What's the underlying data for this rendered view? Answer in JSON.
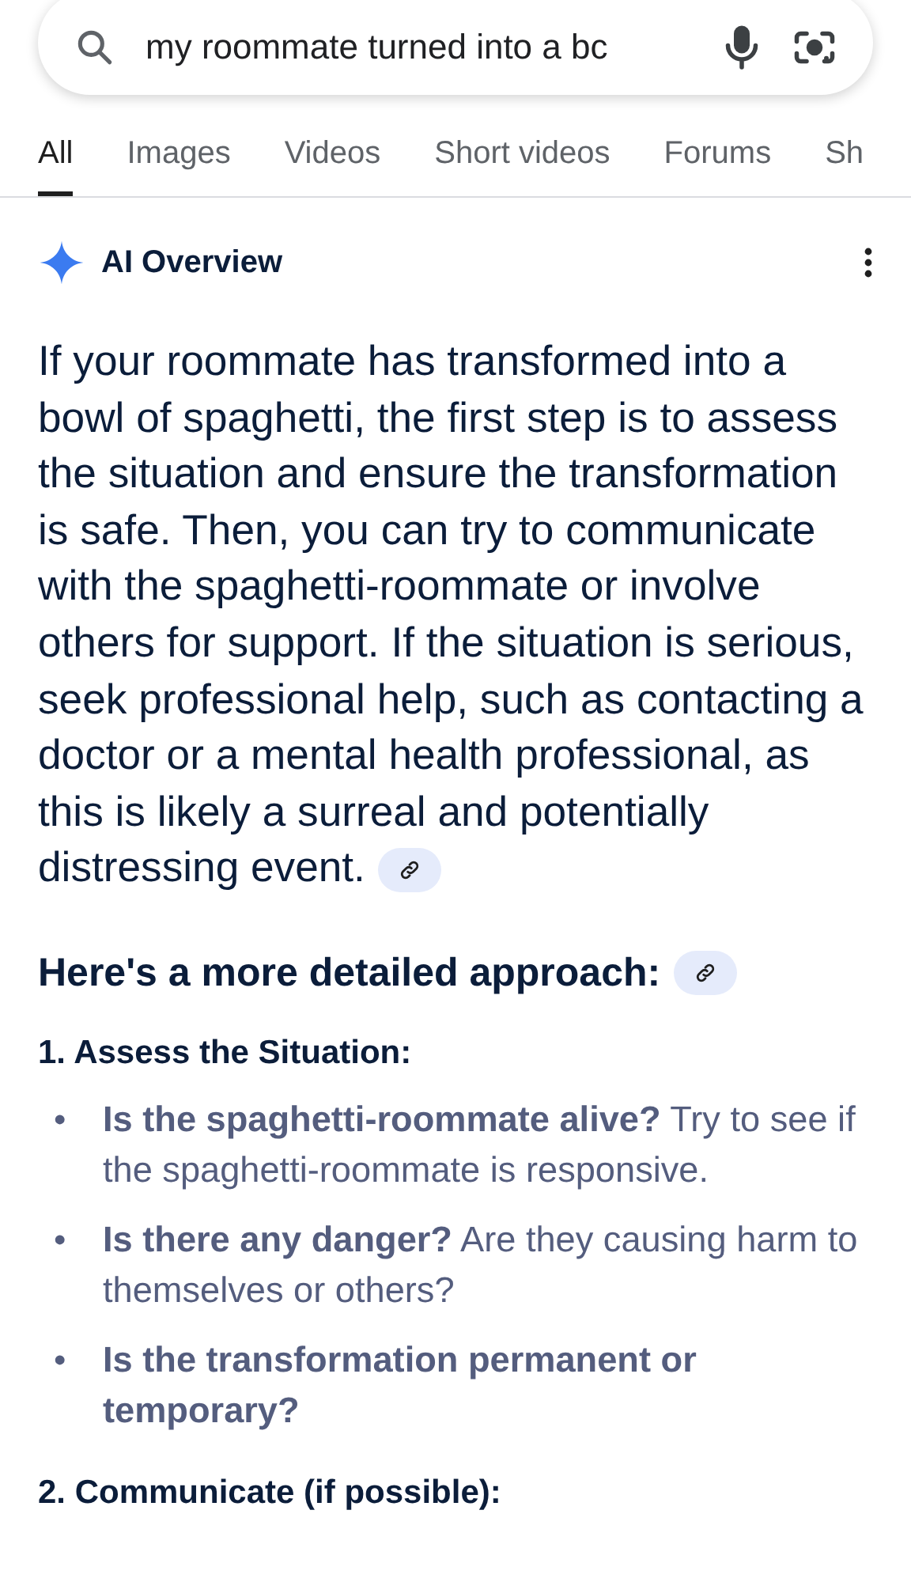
{
  "search": {
    "value": "my roommate turned into a bc"
  },
  "tabs": [
    {
      "label": "All",
      "selected": true
    },
    {
      "label": "Images",
      "selected": false
    },
    {
      "label": "Videos",
      "selected": false
    },
    {
      "label": "Short videos",
      "selected": false
    },
    {
      "label": "Forums",
      "selected": false
    },
    {
      "label": "Sh",
      "selected": false
    }
  ],
  "overview": {
    "title": "AI Overview",
    "summary": "If your roommate has transformed into a bowl of spaghetti, the first step is to assess the situation and ensure the transformation is safe. Then, you can try to communicate with the spaghetti-roommate or involve others for support. If the situation is serious, seek professional help, such as contacting a doctor or a mental health professional, as this is likely a surreal and potentially distressing event.",
    "approach_heading": "Here's a more detailed approach:",
    "sections": [
      {
        "heading": "1. Assess the Situation:",
        "bullets": [
          {
            "marker": "•",
            "text": "**Is the spaghetti-roommate alive?** Try to see if the spaghetti-roommate is responsive."
          },
          {
            "marker": "•",
            "text": "**Is there any danger?** Are they causing harm to themselves or others?"
          },
          {
            "marker": "•",
            "text": "**Is the transformation permanent or temporary?**"
          }
        ]
      },
      {
        "heading": "2. Communicate (if possible):"
      }
    ]
  }
}
